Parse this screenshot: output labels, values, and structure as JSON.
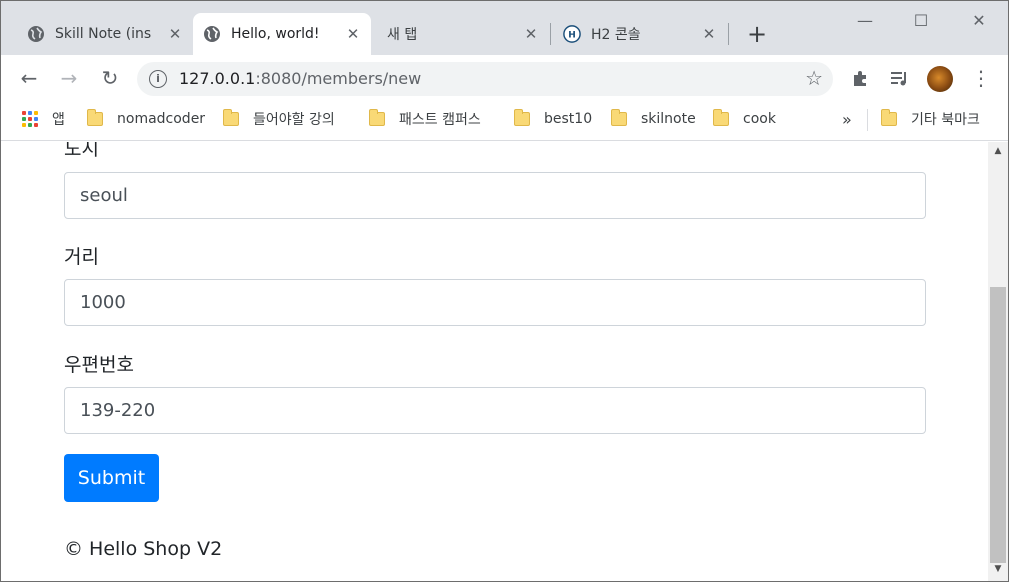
{
  "browser": {
    "tabs": [
      {
        "title": "Skill Note (ins",
        "active": false
      },
      {
        "title": "Hello, world!",
        "active": true
      },
      {
        "title": "새 탭",
        "active": false
      },
      {
        "title": "H2 콘솔",
        "active": false
      }
    ],
    "new_tab_glyph": "+",
    "window_controls": {
      "minimize": "—",
      "maximize": "☐",
      "close": "✕"
    },
    "address": {
      "host": "127.0.0.1",
      "path": ":8080/members/new"
    },
    "bookmarks": [
      {
        "label": "앱",
        "icon": "apps-icon"
      },
      {
        "label": "nomadcoder",
        "icon": "folder-icon"
      },
      {
        "label": "들어야할 강의",
        "icon": "folder-icon"
      },
      {
        "label": "패스트 캠퍼스",
        "icon": "folder-icon"
      },
      {
        "label": "best10",
        "icon": "folder-icon"
      },
      {
        "label": "skilnote",
        "icon": "folder-icon"
      },
      {
        "label": "cook",
        "icon": "folder-icon"
      }
    ],
    "bookmarks_overflow": "»",
    "other_bookmarks": "기타 북마크"
  },
  "form": {
    "fields": [
      {
        "label": "도시",
        "value": "seoul"
      },
      {
        "label": "거리",
        "value": "1000"
      },
      {
        "label": "우편번호",
        "value": "139-220"
      }
    ],
    "submit_label": "Submit"
  },
  "footer": {
    "text": "© Hello Shop V2"
  },
  "colors": {
    "primary": "#007bff",
    "tab_strip": "#dee1e6"
  }
}
